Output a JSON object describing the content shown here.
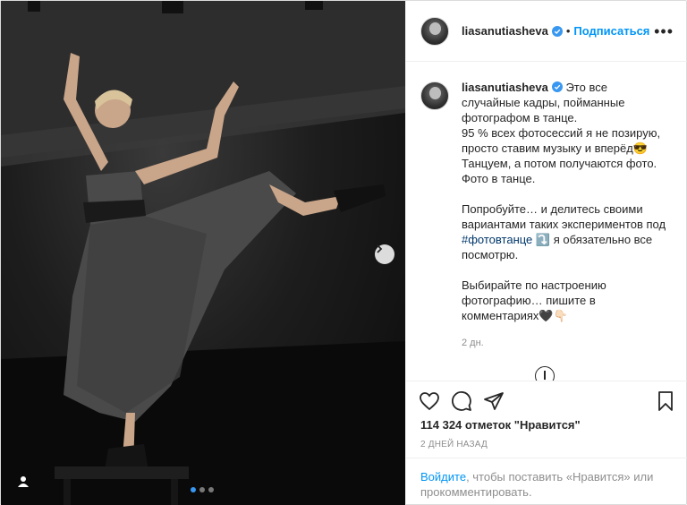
{
  "header": {
    "username": "liasanutiasheva",
    "separator": "•",
    "follow_label": "Подписаться",
    "more_label": "•••"
  },
  "caption": {
    "username": "liasanutiasheva",
    "line1": "Это все случайные кадры, пойманные фотографом в танце.",
    "line2": "95 % всех фотосессий я не позирую, просто ставим музыку и вперёд😎",
    "line3": "Танцуем, а потом получаются фото. Фото в танце.",
    "line4_before": "Попробуйте… и делитесь своими вариантами таких экспериментов под ",
    "hashtag": "#фотовтанце",
    "line4_after": " ⤵️ я обязательно все посмотрю.",
    "line5": "Выбирайте по настроению фотографию… пишите в комментариях🖤👇🏻",
    "time_ago": "2 дн."
  },
  "actions": {
    "like_icon": "heart-icon",
    "comment_icon": "comment-icon",
    "share_icon": "paper-plane-icon",
    "save_icon": "bookmark-icon"
  },
  "likes_text": "114 324 отметок \"Нравится\"",
  "date_text": "2 ДНЕЙ НАЗАД",
  "login": {
    "link": "Войдите",
    "rest": ", чтобы поставить «Нравится» или прокомментировать."
  },
  "carousel": {
    "total": 3,
    "current": 1
  },
  "colors": {
    "accent": "#0095f6",
    "hashtag": "#00376b",
    "muted": "#8e8e8e"
  }
}
